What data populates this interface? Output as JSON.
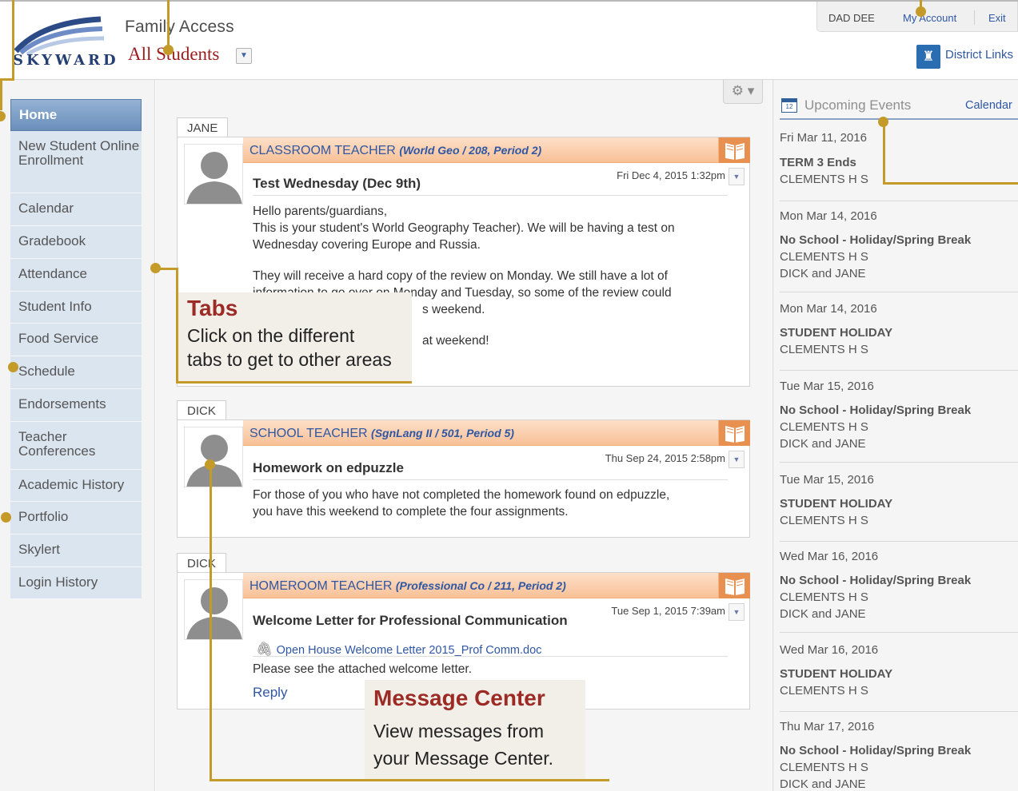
{
  "header": {
    "logo_text": "SKYWARD",
    "app_title": "Family Access",
    "student_selector": "All Students",
    "user_name": "DAD DEE",
    "my_account": "My Account",
    "exit": "Exit",
    "district_links": "District Links"
  },
  "sidebar": {
    "items": [
      {
        "label": "Home",
        "active": true
      },
      {
        "label": "New Student Online Enrollment"
      },
      {
        "label": "Calendar"
      },
      {
        "label": "Gradebook"
      },
      {
        "label": "Attendance"
      },
      {
        "label": "Student Info"
      },
      {
        "label": "Food Service"
      },
      {
        "label": "Schedule"
      },
      {
        "label": "Endorsements"
      },
      {
        "label": "Teacher Conferences"
      },
      {
        "label": "Academic History"
      },
      {
        "label": "Portfolio"
      },
      {
        "label": "Skylert"
      },
      {
        "label": "Login History"
      }
    ]
  },
  "messages": [
    {
      "student": "JANE",
      "sender": "CLASSROOM TEACHER",
      "course": "(World Geo / 208, Period 2)",
      "subject": "Test Wednesday (Dec 9th)",
      "date": "Fri Dec 4, 2015 1:32pm",
      "body": [
        "Hello parents/guardians,",
        "This is your student's World Geography Teacher). We will be having a test on",
        "Wednesday covering Europe and Russia.",
        "They will receive a hard copy of the review on Monday. We still have a lot of",
        "information to go over on Monday and Tuesday, so some of the review could",
        "s weekend.",
        "at weekend!"
      ]
    },
    {
      "student": "DICK",
      "sender": "SCHOOL TEACHER",
      "course": "(SgnLang II / 501, Period 5)",
      "subject": "Homework on edpuzzle",
      "date": "Thu Sep 24, 2015 2:58pm",
      "body": [
        "For those of you who have not completed the homework found on edpuzzle,",
        "you have this weekend to complete the four assignments."
      ]
    },
    {
      "student": "DICK",
      "sender": "HOMEROOM TEACHER",
      "course": "(Professional Co / 211, Period 2)",
      "subject": "Welcome Letter for Professional Communication",
      "date": "Tue Sep 1, 2015 7:39am",
      "attachment": "Open House Welcome Letter 2015_Prof Comm.doc",
      "body": [
        "Please see the attached welcome letter."
      ],
      "reply": "Reply"
    }
  ],
  "events": {
    "title": "Upcoming Events",
    "calendar_link": "Calendar",
    "icon": "calendar-icon",
    "items": [
      {
        "date": "Fri Mar 11, 2016",
        "title": "TERM 3 Ends",
        "lines": [
          "CLEMENTS H S"
        ]
      },
      {
        "date": "Mon Mar 14, 2016",
        "title": "No School - Holiday/Spring Break",
        "lines": [
          "CLEMENTS H S",
          "DICK and JANE"
        ]
      },
      {
        "date": "Mon Mar 14, 2016",
        "title": "STUDENT HOLIDAY",
        "lines": [
          "CLEMENTS H S"
        ]
      },
      {
        "date": "Tue Mar 15, 2016",
        "title": "No School - Holiday/Spring Break",
        "lines": [
          "CLEMENTS H S",
          "DICK and JANE"
        ]
      },
      {
        "date": "Tue Mar 15, 2016",
        "title": "STUDENT HOLIDAY",
        "lines": [
          "CLEMENTS H S"
        ]
      },
      {
        "date": "Wed Mar 16, 2016",
        "title": "No School - Holiday/Spring Break",
        "lines": [
          "CLEMENTS H S",
          "DICK and JANE"
        ]
      },
      {
        "date": "Wed Mar 16, 2016",
        "title": "STUDENT HOLIDAY",
        "lines": [
          "CLEMENTS H S"
        ]
      },
      {
        "date": "Thu Mar 17, 2016",
        "title": "No School - Holiday/Spring Break",
        "lines": [
          "CLEMENTS H S",
          "DICK and JANE"
        ]
      }
    ]
  },
  "callouts": {
    "tabs": {
      "title": "Tabs",
      "lines": [
        "Click on the different",
        "tabs to get to other areas"
      ]
    },
    "message_center": {
      "title": "Message Center",
      "lines": [
        "View messages from",
        "your Message Center."
      ]
    }
  },
  "colors": {
    "accent": "#c49a28",
    "callout_title": "#9c2a25",
    "link": "#2f57a4",
    "message_header": "#f8c197"
  }
}
